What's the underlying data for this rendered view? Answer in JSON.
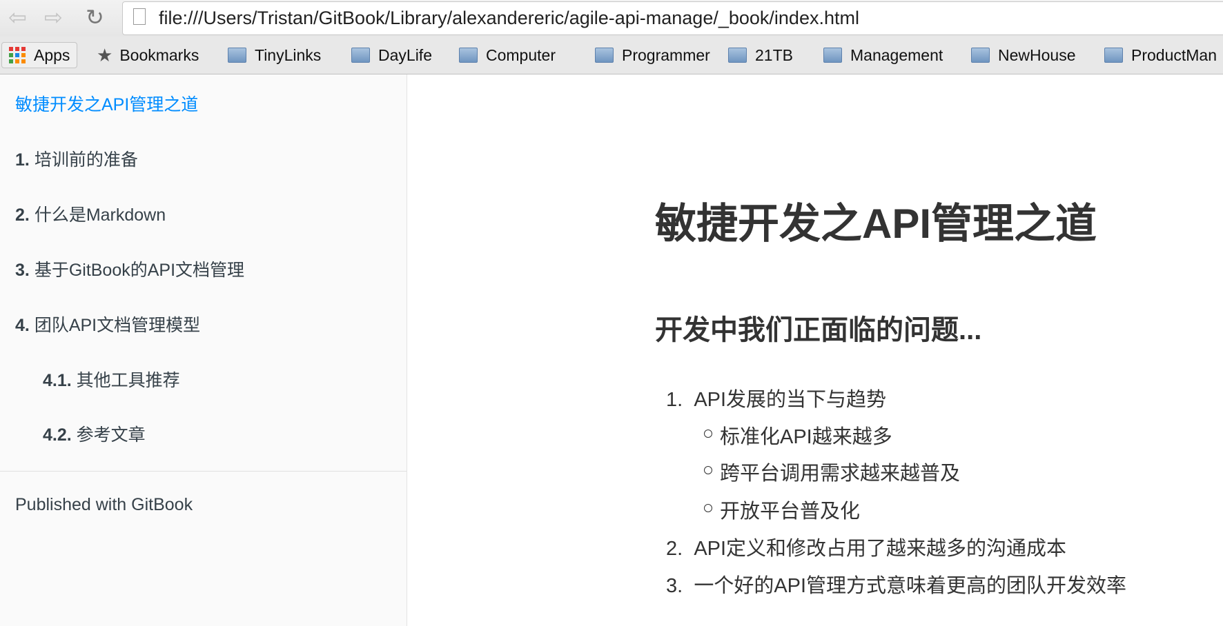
{
  "browser": {
    "url": "file:///Users/Tristan/GitBook/Library/alexandereric/agile-api-manage/_book/index.html",
    "bookmarks": [
      "Apps",
      "Bookmarks",
      "TinyLinks",
      "DayLife",
      "Computer",
      "Programmer",
      "21TB",
      "Management",
      "NewHouse",
      "ProductMan"
    ]
  },
  "sidebar": {
    "home": "敏捷开发之API管理之道",
    "items": [
      {
        "num": "1.",
        "label": "培训前的准备"
      },
      {
        "num": "2.",
        "label": "什么是Markdown"
      },
      {
        "num": "3.",
        "label": "基于GitBook的API文档管理"
      },
      {
        "num": "4.",
        "label": "团队API文档管理模型"
      },
      {
        "num": "4.1.",
        "label": "其他工具推荐"
      },
      {
        "num": "4.2.",
        "label": "参考文章"
      }
    ],
    "footer": "Published with GitBook"
  },
  "content": {
    "title": "敏捷开发之API管理之道",
    "subtitle": "开发中我们正面临的问题...",
    "list": [
      {
        "num": "1.",
        "text": "API发展的当下与趋势",
        "sub": [
          "标准化API越来越多",
          "跨平台调用需求越来越普及",
          "开放平台普及化"
        ]
      },
      {
        "num": "2.",
        "text": "API定义和修改占用了越来越多的沟通成本"
      },
      {
        "num": "3.",
        "text": "一个好的API管理方式意味着更高的团队开发效率"
      }
    ]
  },
  "colors": {
    "link": "#008cff",
    "text": "#333333"
  }
}
